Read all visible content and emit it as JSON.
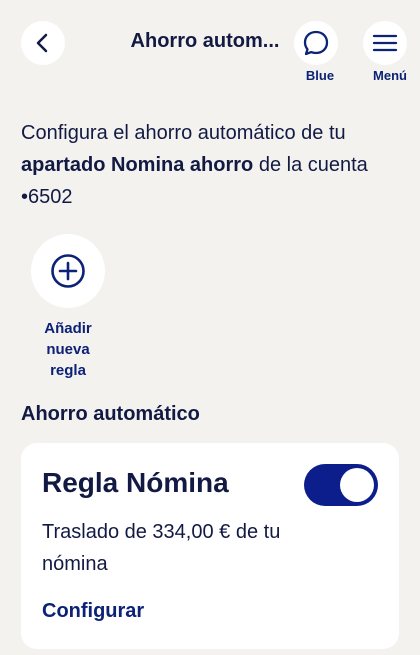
{
  "header": {
    "title": "Ahorro autom...",
    "blue_label": "Blue",
    "menu_label": "Menú",
    "icons": [
      "back-chevron-icon",
      "chat-bubble-icon",
      "hamburger-menu-icon"
    ]
  },
  "intro": {
    "part1": "Configura el ahorro automático de tu ",
    "bold": "apartado Nomina ahorro",
    "part2": " de la cuenta",
    "account": "•6502"
  },
  "add_rule": {
    "label_line1": "Añadir",
    "label_line2": "nueva",
    "label_line3": "regla",
    "icon": "plus-circle-icon"
  },
  "section": {
    "title": "Ahorro automático"
  },
  "rule_card": {
    "name": "Regla Nómina",
    "enabled": true,
    "description": "Traslado de 334,00 € de tu nómina",
    "action_label": "Configurar"
  },
  "colors": {
    "background": "#f4f2ef",
    "text": "#121a43",
    "accent": "#0c1d8c",
    "card": "#ffffff"
  }
}
